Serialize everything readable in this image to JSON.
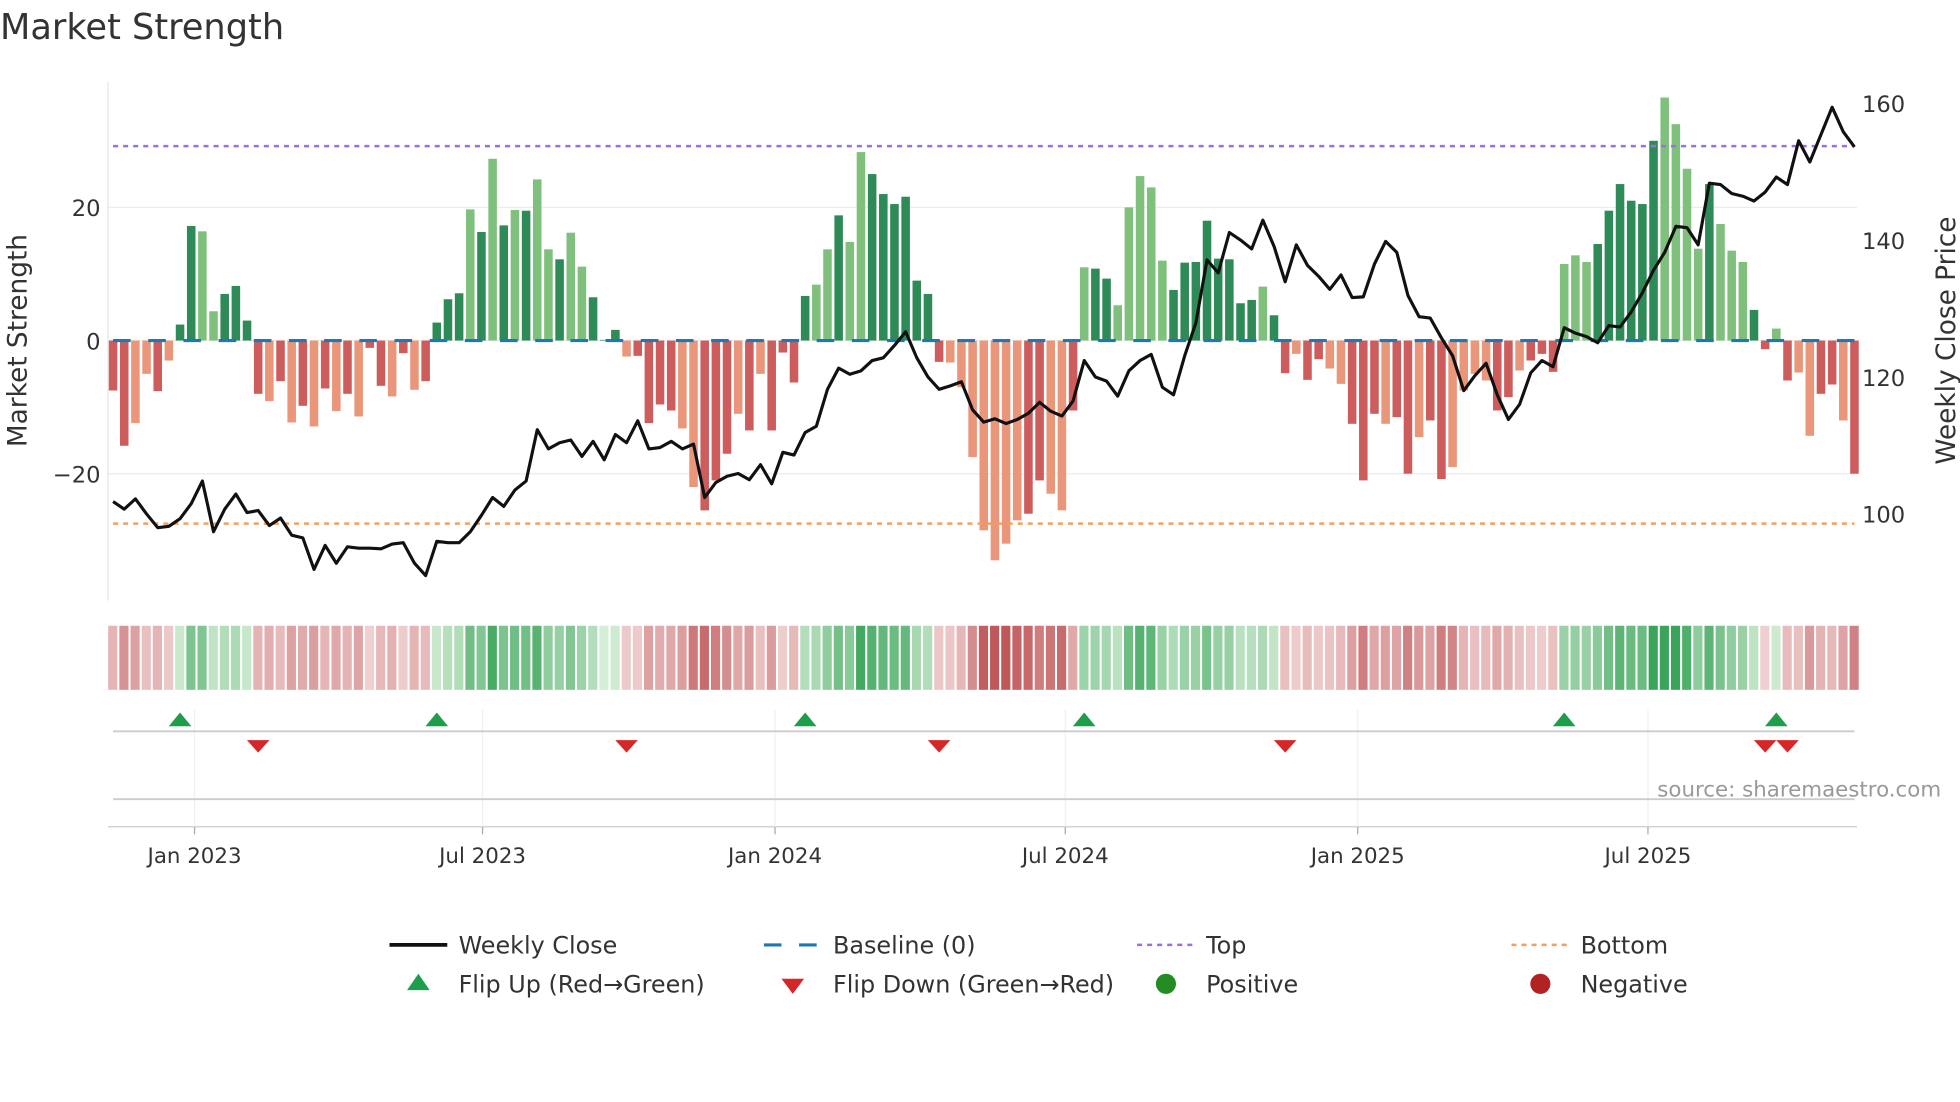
{
  "chart_data": {
    "type": "bar",
    "title": "Market Strength",
    "ylabel": "Market Strength",
    "y2label": "Weekly Close Price",
    "ylim": [
      -39,
      39
    ],
    "y2lim": [
      85,
      162
    ],
    "yticks": [
      {
        "value": 20,
        "label": "20"
      },
      {
        "value": 0,
        "label": "0"
      },
      {
        "value": -20,
        "label": "−20"
      }
    ],
    "y2ticks": [
      {
        "value": 100,
        "label": "100"
      },
      {
        "value": 120,
        "label": "120"
      },
      {
        "value": 140,
        "label": "140"
      },
      {
        "value": 160,
        "label": "160"
      }
    ],
    "xticks": [
      {
        "label": "Jan 2023",
        "week_index": 7.3
      },
      {
        "label": "Jul 2023",
        "week_index": 33.1
      },
      {
        "label": "Jan 2024",
        "week_index": 59.3
      },
      {
        "label": "Jul 2024",
        "week_index": 85.3
      },
      {
        "label": "Jan 2025",
        "week_index": 111.5
      },
      {
        "label": "Jul 2025",
        "week_index": 137.5
      }
    ],
    "top_level": 29.2,
    "bottom_level": -27.5,
    "baseline": 0,
    "strength": [
      -7.5,
      -15.8,
      -12.4,
      -5,
      -7.6,
      -3,
      2.4,
      17.2,
      16.4,
      4.4,
      7,
      8.2,
      3,
      -8,
      -9.1,
      -6.1,
      -12.3,
      -9.8,
      -12.9,
      -7.2,
      -10.6,
      -8,
      -11.4,
      -1.1,
      -6.8,
      -8.4,
      -1.9,
      -7.4,
      -6.1,
      2.7,
      6.2,
      7.1,
      19.7,
      16.3,
      27.3,
      17.3,
      19.6,
      19.5,
      24.2,
      13.7,
      12.2,
      16.2,
      11.1,
      6.5,
      0.1,
      1.6,
      -2.4,
      -2.3,
      -12.4,
      -9.6,
      -10.5,
      -13.2,
      -22,
      -25.5,
      -21,
      -17,
      -11,
      -13.5,
      -5,
      -13.5,
      -1.8,
      -6.3,
      6.7,
      8.4,
      13.7,
      18.8,
      14.8,
      28.3,
      25,
      22,
      20.5,
      21.6,
      9,
      7,
      -3.2,
      -3.3,
      -7,
      -17.5,
      -28.5,
      -33,
      -30.5,
      -27,
      -26,
      -21,
      -23,
      -25.5,
      -10.5,
      11,
      10.8,
      9.3,
      5.3,
      20,
      24.7,
      23,
      12,
      7.6,
      11.7,
      11.8,
      18,
      12.3,
      12.2,
      5.6,
      6.1,
      8.1,
      3.8,
      -4.9,
      -2,
      -5.9,
      -2.8,
      -4.2,
      -6.5,
      -12.5,
      -21,
      -11,
      -12.5,
      -11.5,
      -20,
      -14.5,
      -12,
      -20.8,
      -19,
      -7.5,
      -5,
      -6,
      -10.5,
      -8.5,
      -4.5,
      -3,
      -2,
      -4.7,
      11.5,
      12.8,
      11.8,
      14.5,
      19.5,
      23.5,
      21,
      20.5,
      30,
      36.5,
      32.5,
      25.8,
      13.8,
      23.5,
      17.5,
      13.5,
      11.8,
      4.6,
      -1.3,
      1.8,
      -6,
      -4.8,
      -14.3,
      -8,
      -6.6,
      -12,
      -20
    ],
    "strength_rising": "ddlldldd lldd ddldldldldlddldl ddddldldldlldlld ddlddddlldddldlddddlld ll ddd dddd lll llll ddlld lddlllllddddddddlddlddlldddlddlddllll ddldd dlll dddddd lllldll lddl dl ldd ldl",
    "weekly_close": [
      101.8,
      100.7,
      102.2,
      100,
      98,
      98.2,
      99.3,
      101.5,
      104.8,
      97.4,
      100.7,
      102.9,
      100.2,
      100.5,
      98.3,
      99.4,
      96.9,
      96.5,
      91.9,
      95.4,
      92.8,
      95.2,
      95,
      95,
      94.9,
      95.6,
      95.8,
      92.8,
      91,
      96,
      95.8,
      95.8,
      97.4,
      99.8,
      102.4,
      101.1,
      103.5,
      104.8,
      112.3,
      109.5,
      110.4,
      110.8,
      108.4,
      110.6,
      107.9,
      111.6,
      110.4,
      113.6,
      109.5,
      109.7,
      110.6,
      109.5,
      110.2,
      102.4,
      104.6,
      105.5,
      105.9,
      105,
      107.2,
      104.4,
      109,
      108.6,
      111.9,
      112.8,
      118.2,
      121.3,
      120.4,
      120.9,
      122.4,
      122.8,
      124.6,
      126.6,
      122.8,
      120,
      118.2,
      118.7,
      119.3,
      115.2,
      113.4,
      113.9,
      113.2,
      113.8,
      114.7,
      116.3,
      115,
      114.3,
      116.5,
      122.4,
      120,
      119.4,
      117.2,
      120.9,
      122.4,
      123.3,
      118.5,
      117.4,
      123.1,
      127.9,
      137.1,
      135.2,
      141.1,
      140,
      138.7,
      142.9,
      139.1,
      133.9,
      139.3,
      136.3,
      134.7,
      132.8,
      134.9,
      131.6,
      131.7,
      136.5,
      139.8,
      138.2,
      131.9,
      128.8,
      128.6,
      125.7,
      123.1,
      118,
      120.2,
      122,
      117.4,
      113.8,
      116,
      120.6,
      122.4,
      121.5,
      127.2,
      126.4,
      125.9,
      125,
      127.5,
      127.3,
      129.5,
      132.3,
      135.6,
      138.2,
      142,
      141.8,
      139.3,
      148.3,
      148.1,
      146.8,
      146.4,
      145.7,
      147,
      149.2,
      148.1,
      154.5,
      151.4,
      155.4,
      159.4,
      155.8,
      153.6
    ],
    "flip_up_week_index": [
      6,
      29,
      62,
      87,
      130,
      149
    ],
    "flip_down_week_index": [
      13,
      46,
      74,
      105,
      148,
      150
    ],
    "legend": [
      {
        "label": "Weekly Close",
        "kind": "line",
        "color": "#111111"
      },
      {
        "label": "Baseline (0)",
        "kind": "dash",
        "color": "#1f77b4"
      },
      {
        "label": "Top",
        "kind": "dot",
        "color": "#9b6fe0"
      },
      {
        "label": "Bottom",
        "kind": "dot",
        "color": "#f0a060"
      },
      {
        "label": "Flip Up (Red→Green)",
        "kind": "up",
        "color": "#1e9e4a"
      },
      {
        "label": "Flip Down (Green→Red)",
        "kind": "down",
        "color": "#d62728"
      },
      {
        "label": "Positive",
        "kind": "circle",
        "color": "#228b22"
      },
      {
        "label": "Negative",
        "kind": "circle",
        "color": "#b22222"
      }
    ],
    "legend_placement": "bottom",
    "colors": {
      "pos_strong": "#2e8b57",
      "pos_weak": "#80c07d",
      "neg_strong": "#cd5c5c",
      "neg_weak": "#e9967a",
      "line": "#111111"
    },
    "source": "source: sharemaestro.com"
  }
}
